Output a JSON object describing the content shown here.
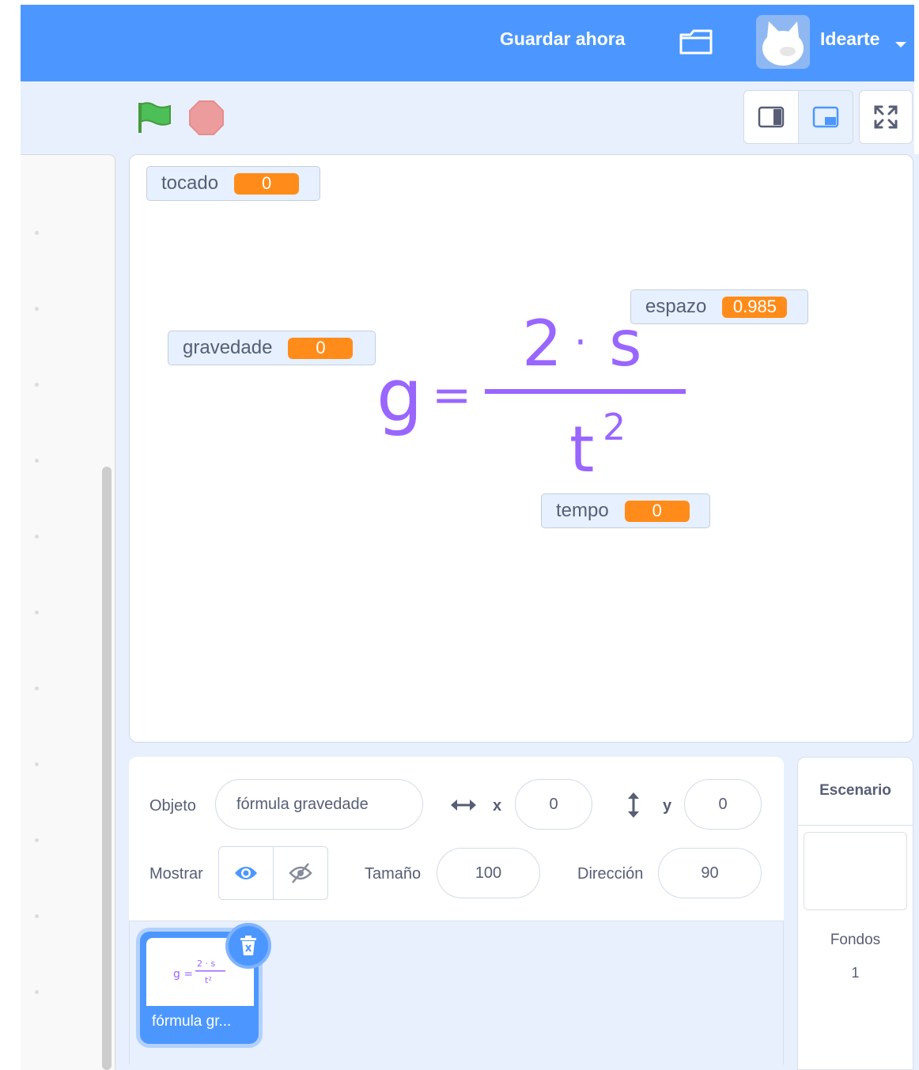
{
  "menu": {
    "save_now": "Guardar ahora",
    "username": "Idearte",
    "bar_color": "#4c97ff"
  },
  "toolbar": {
    "green_flag_icon": "green-flag-icon",
    "stop_icon": "stop-icon"
  },
  "stage": {
    "monitors": [
      {
        "label": "tocado",
        "value": "0"
      },
      {
        "label": "gravedade",
        "value": "0"
      },
      {
        "label": "espazo",
        "value": "0.985"
      },
      {
        "label": "tempo",
        "value": "0"
      }
    ],
    "formula": {
      "lhs": "g",
      "equals": "=",
      "numerator_left": "2",
      "dot": "·",
      "numerator_right": "s",
      "denominator": "t",
      "exponent": "2",
      "color": "#9966ff"
    }
  },
  "sprite_info": {
    "sprite_label": "Objeto",
    "sprite_name": "fórmula gravedade",
    "x_label": "x",
    "x_value": "0",
    "y_label": "y",
    "y_value": "0",
    "show_label": "Mostrar",
    "size_label": "Tamaño",
    "size_value": "100",
    "direction_label": "Dirección",
    "direction_value": "90"
  },
  "sprite_list": {
    "tiles": [
      {
        "label": "fórmula gr..."
      }
    ]
  },
  "stage_selector": {
    "header": "Escenario",
    "backdrops_label": "Fondos",
    "backdrops_count": "1"
  }
}
